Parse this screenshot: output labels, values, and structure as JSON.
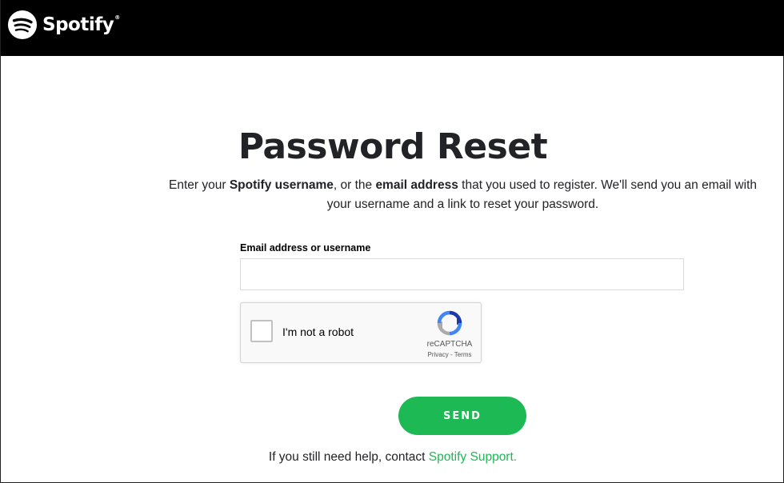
{
  "header": {
    "brand": "Spotify",
    "trademark": "®",
    "logo_icon": "spotify-logo-icon"
  },
  "page": {
    "title": "Password Reset",
    "intro_prefix": "Enter your ",
    "intro_bold1": "Spotify username",
    "intro_mid": ", or the ",
    "intro_bold2": "email address",
    "intro_suffix": " that you used to register. We'll send you an email with your username and a link to reset your password."
  },
  "form": {
    "field_label": "Email address or username",
    "field_value": "",
    "field_placeholder": "",
    "send_label": "SEND"
  },
  "captcha": {
    "label": "I'm not a robot",
    "brand": "reCAPTCHA",
    "privacy": "Privacy",
    "separator": " - ",
    "terms": "Terms",
    "checked": false
  },
  "footer": {
    "help_text": "If you still need help, contact ",
    "support_link": "Spotify Support."
  },
  "colors": {
    "accent": "#1db954",
    "header_bg": "#000000",
    "text": "#222326"
  }
}
